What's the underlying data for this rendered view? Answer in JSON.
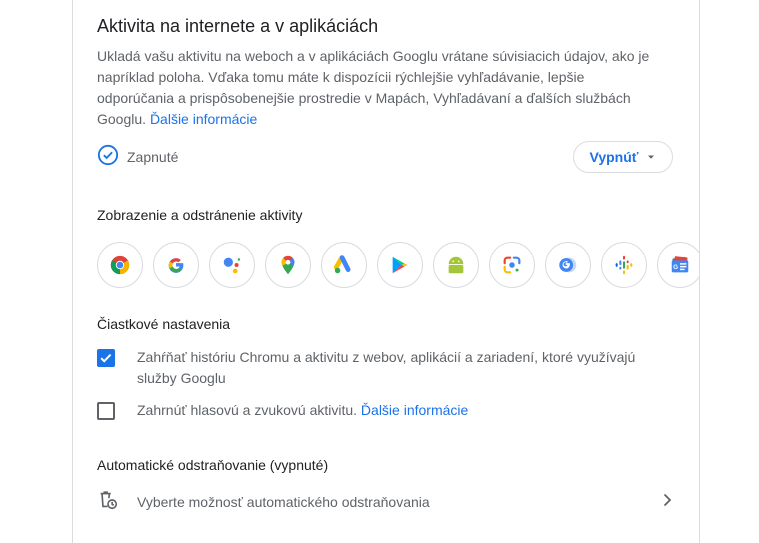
{
  "card": {
    "title": "Aktivita na internete a v aplikáciách",
    "description": "Ukladá vašu aktivitu na weboch a v aplikáciách Googlu vrátane súvisiacich údajov, ako je napríklad poloha. Vďaka tomu máte k dispozícii rýchlejšie vyhľadávanie, lepšie odporúčania a prispôsobenejšie prostredie v Mapách, Vyhľadávaní a ďalších službách Googlu.",
    "learn_more": "Ďalšie informácie",
    "status_label": "Zapnuté",
    "turn_off_label": "Vypnúť"
  },
  "activity": {
    "heading": "Zobrazenie a odstránenie aktivity",
    "apps": [
      {
        "icon": "chrome-icon"
      },
      {
        "icon": "google-icon"
      },
      {
        "icon": "google-assistant-icon"
      },
      {
        "icon": "google-maps-icon"
      },
      {
        "icon": "google-ads-icon"
      },
      {
        "icon": "google-play-icon"
      },
      {
        "icon": "android-icon"
      },
      {
        "icon": "google-lens-icon"
      },
      {
        "icon": "google-translate-icon"
      },
      {
        "icon": "google-podcasts-icon"
      },
      {
        "icon": "google-news-icon"
      }
    ]
  },
  "subsettings": {
    "heading": "Čiastkové nastavenia",
    "chrome_history": {
      "label": "Zahŕňať históriu Chromu a aktivitu z webov, aplikácií a zariadení, ktoré využívajú služby Googlu",
      "checked": true
    },
    "voice_audio": {
      "label": "Zahrnúť hlasovú a zvukovú aktivitu.",
      "link": "Ďalšie informácie",
      "checked": false
    }
  },
  "auto_delete": {
    "heading": "Automatické odstraňovanie (vypnuté)",
    "option_label": "Vyberte možnosť automatického odstraňovania"
  },
  "colors": {
    "accent": "#1a73e8",
    "border": "#dadce0",
    "text_secondary": "#5f6368"
  }
}
